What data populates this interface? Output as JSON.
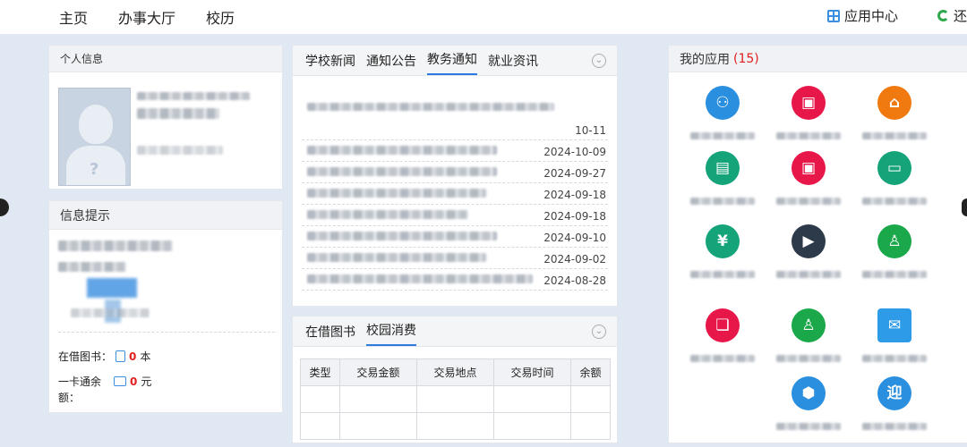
{
  "nav": {
    "home": "主页",
    "hall": "办事大厅",
    "calendar": "校历"
  },
  "topright": {
    "app_center": "应用中心",
    "return": "还"
  },
  "personal": {
    "title": "个人信息",
    "avatar_mark": "?"
  },
  "tips": {
    "title": "信息提示",
    "books_label": "在借图书：",
    "books_num": "0",
    "books_unit": "本",
    "card_label_1": "一卡通余",
    "card_label_2": "额：",
    "card_num": "0",
    "card_unit": "元"
  },
  "news": {
    "tabs": [
      "学校新闻",
      "通知公告",
      "教务通知",
      "就业资讯"
    ],
    "active_tab": 2,
    "dates": [
      "10-11",
      "2024-10-09",
      "2024-09-27",
      "2024-09-18",
      "2024-09-18",
      "2024-09-10",
      "2024-09-02",
      "2024-08-28"
    ]
  },
  "borrow": {
    "tabs": [
      "在借图书",
      "校园消费"
    ],
    "active_tab": 1,
    "columns": [
      "类型",
      "交易金额",
      "交易地点",
      "交易时间",
      "余额"
    ]
  },
  "apps": {
    "title": "我的应用",
    "count": "(15)",
    "icons": [
      {
        "name": "people-group-icon",
        "color": "#2b8fe0",
        "glyph": "⚇"
      },
      {
        "name": "monitor-person-icon",
        "color": "#e8174a",
        "glyph": "▣"
      },
      {
        "name": "building-icon",
        "color": "#f07a10",
        "glyph": "⌂"
      },
      {
        "name": "briefcase-icon",
        "color": "#15a37a",
        "glyph": "▤"
      },
      {
        "name": "screen-alert-icon",
        "color": "#e8174a",
        "glyph": "▣"
      },
      {
        "name": "credit-card-icon",
        "color": "#15a37a",
        "glyph": "▭"
      },
      {
        "name": "clipboard-icon",
        "color": "#15a37a",
        "glyph": "¥"
      },
      {
        "name": "play-screen-icon",
        "color": "#2d3a4a",
        "glyph": "▶"
      },
      {
        "name": "teacher-icon",
        "color": "#1aa84a",
        "glyph": "♙"
      },
      {
        "name": "book-icon",
        "color": "#e8174a",
        "glyph": "❏"
      },
      {
        "name": "presenter-icon",
        "color": "#1aa84a",
        "glyph": "♙"
      },
      {
        "name": "envelope-icon",
        "color": "#2d9be8",
        "glyph": "✉"
      },
      {
        "name": "box-icon",
        "color": "#2b8fe0",
        "glyph": "⬢"
      },
      {
        "name": "welcome-icon",
        "color": "#2b8fe0",
        "glyph": "迎"
      }
    ]
  }
}
